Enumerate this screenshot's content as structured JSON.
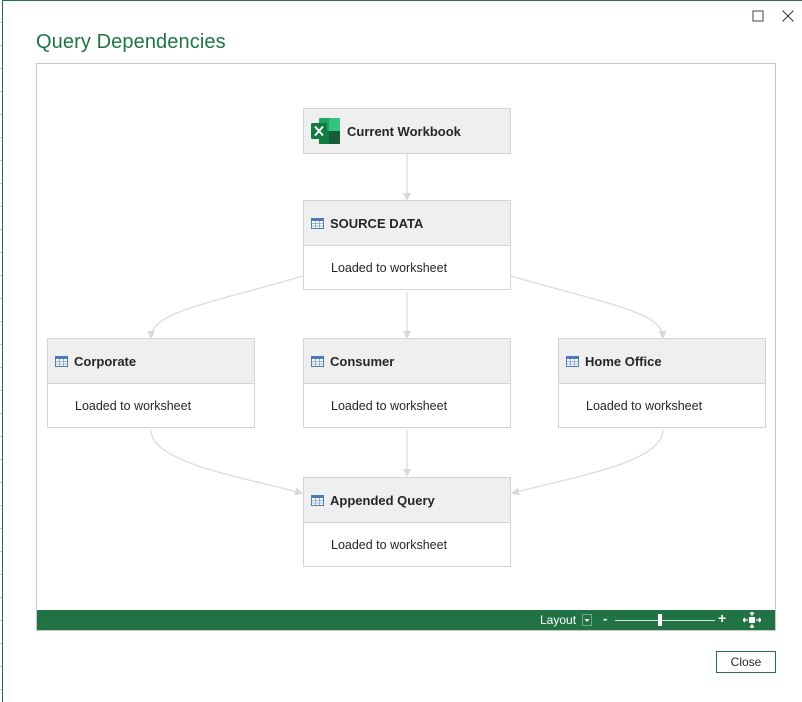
{
  "dialog": {
    "title": "Query Dependencies",
    "close_button_label": "Close"
  },
  "nodes": [
    {
      "id": "current-workbook",
      "name": "Current Workbook",
      "icon": "excel-icon",
      "status": ""
    },
    {
      "id": "source-data",
      "name": "SOURCE DATA",
      "icon": "table-icon",
      "status": "Loaded to worksheet"
    },
    {
      "id": "corporate",
      "name": "Corporate",
      "icon": "table-icon",
      "status": "Loaded to worksheet"
    },
    {
      "id": "consumer",
      "name": "Consumer",
      "icon": "table-icon",
      "status": "Loaded to worksheet"
    },
    {
      "id": "home-office",
      "name": "Home Office",
      "icon": "table-icon",
      "status": "Loaded to worksheet"
    },
    {
      "id": "appended-query",
      "name": "Appended Query",
      "icon": "table-icon",
      "status": "Loaded to worksheet"
    }
  ],
  "edges": [
    {
      "from": "current-workbook",
      "to": "source-data"
    },
    {
      "from": "source-data",
      "to": "corporate"
    },
    {
      "from": "source-data",
      "to": "consumer"
    },
    {
      "from": "source-data",
      "to": "home-office"
    },
    {
      "from": "corporate",
      "to": "appended-query"
    },
    {
      "from": "consumer",
      "to": "appended-query"
    },
    {
      "from": "home-office",
      "to": "appended-query"
    }
  ],
  "statusbar": {
    "layout_label": "Layout",
    "zoom_out_symbol": "-",
    "zoom_in_symbol": "+",
    "zoom_level": 0.45
  },
  "colors": {
    "accent": "#217346",
    "edge": "#d9d9d9",
    "node_header": "#efefef"
  }
}
